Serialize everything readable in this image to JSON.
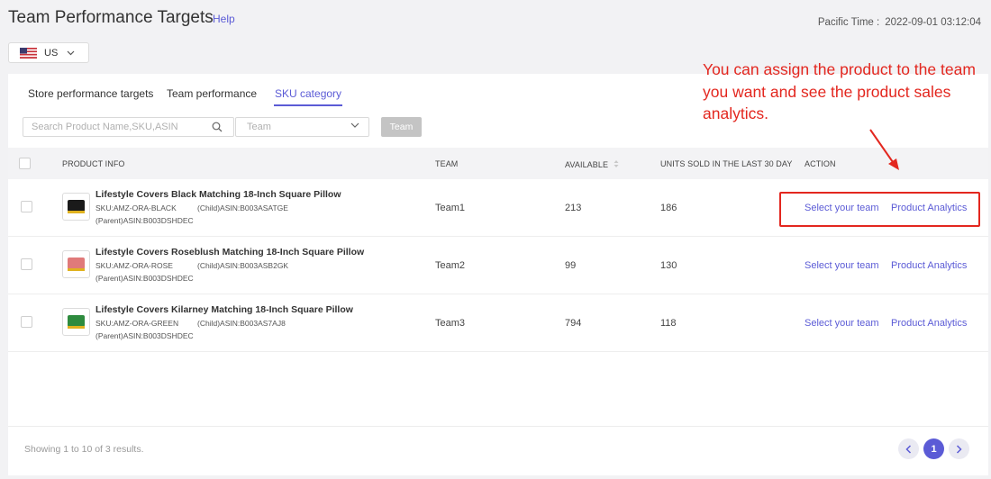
{
  "header": {
    "title": "Team Performance Targets",
    "help_label": "Help",
    "time_label": "Pacific Time :",
    "time_value": "2022-09-01 03:12:04"
  },
  "country": {
    "selected": "US",
    "flag_icon": "us-flag-icon"
  },
  "tabs": [
    {
      "label": "Store performance targets"
    },
    {
      "label": "Team performance"
    },
    {
      "label": "SKU category"
    }
  ],
  "active_tab": "SKU category",
  "filters": {
    "search_placeholder": "Search Product Name,SKU,ASIN",
    "team_placeholder": "Team",
    "team_button_label": "Team"
  },
  "table": {
    "columns": {
      "product_info": "PRODUCT INFO",
      "team": "TEAM",
      "available": "AVAILABLE",
      "units_sold": "UNITS SOLD IN THE LAST 30 DAY",
      "action": "ACTION"
    },
    "rows": [
      {
        "title": "Lifestyle Covers Black Matching 18-Inch Square Pillow",
        "sku": "SKU:AMZ-ORA-BLACK",
        "child_asin": "(Child)ASIN:B003ASATGE",
        "parent_asin": "(Parent)ASIN:B003DSHDEC",
        "team": "Team1",
        "available": "213",
        "units_sold": "186",
        "color": "#1a1a1a",
        "action_team": "Select your team",
        "action_analytics": "Product Analytics"
      },
      {
        "title": "Lifestyle Covers Roseblush Matching 18-Inch Square Pillow",
        "sku": "SKU:AMZ-ORA-ROSE",
        "child_asin": "(Child)ASIN:B003ASB2GK",
        "parent_asin": "(Parent)ASIN:B003DSHDEC",
        "team": "Team2",
        "available": "99",
        "units_sold": "130",
        "color": "#e07a7a",
        "action_team": "Select your team",
        "action_analytics": "Product Analytics"
      },
      {
        "title": "Lifestyle Covers Kilarney Matching 18-Inch Square Pillow",
        "sku": "SKU:AMZ-ORA-GREEN",
        "child_asin": "(Child)ASIN:B003AS7AJ8",
        "parent_asin": "(Parent)ASIN:B003DSHDEC",
        "team": "Team3",
        "available": "794",
        "units_sold": "118",
        "color": "#2e8b3e",
        "action_team": "Select your team",
        "action_analytics": "Product Analytics"
      }
    ]
  },
  "footer": {
    "showing": "Showing 1 to 10 of 3 results.",
    "current_page": "1"
  },
  "annotation": {
    "text": "You can assign the product to the team you want and see the product sales analytics.",
    "color": "#e3271f"
  },
  "colors": {
    "accent": "#5b5bd6",
    "highlight": "#e3271f"
  }
}
